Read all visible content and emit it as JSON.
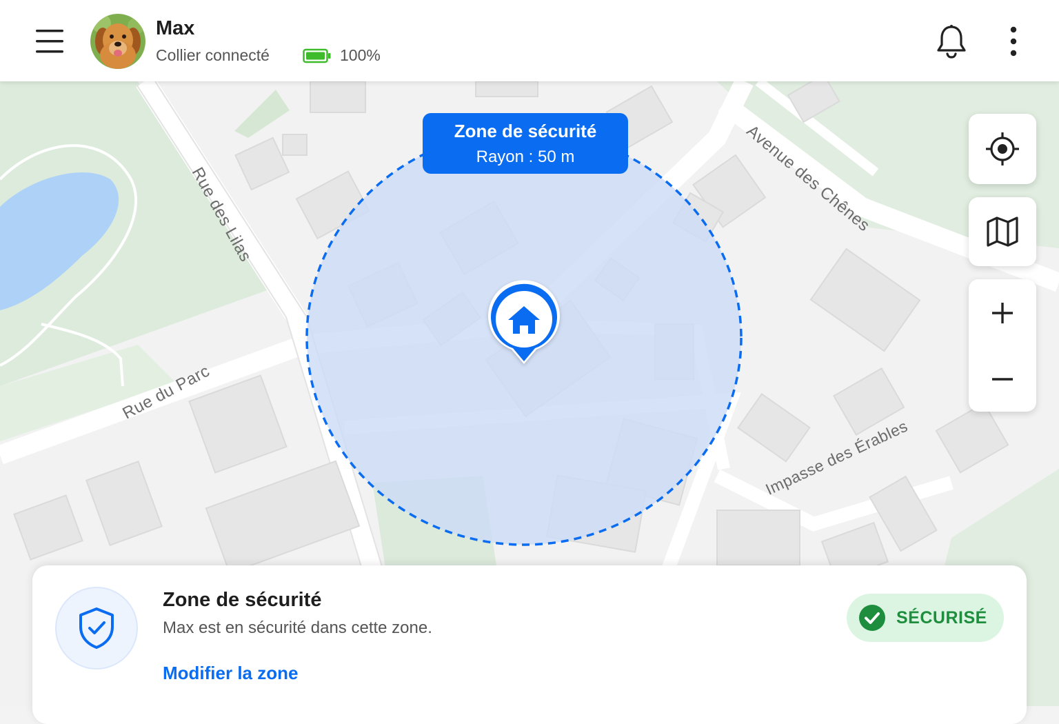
{
  "header": {
    "pet_name": "Max",
    "collar_status": "Collier connecté",
    "battery_level": "100%",
    "battery_fraction": 1.0,
    "battery_color": "#3dbb2a",
    "icons": [
      "menu-icon",
      "dog-avatar",
      "battery-icon",
      "bell-icon",
      "more-vert-icon"
    ]
  },
  "map": {
    "streets": {
      "rue_des_lilas": "Rue des Lilas",
      "rue_du_parc": "Rue du Parc",
      "avenue_des_chenes": "Avenue des Chênes",
      "impasse_des_erables": "Impasse des Érables"
    },
    "zone": {
      "title": "Zone de sécurité",
      "radius_label": "Rayon : 50 m",
      "fill_color": "#cddcf6",
      "stroke_color": "#0a6cf0"
    },
    "controls": [
      "locate-icon",
      "map-layers-icon",
      "zoom-in-icon",
      "zoom-out-icon"
    ]
  },
  "card": {
    "title": "Zone de sécurité",
    "description": "Max est en sécurité dans cette zone.",
    "link": "Modifier la zone",
    "status": "SÉCURISÉ",
    "status_color": "#1e8e3e",
    "accent_color": "#0a6cf0"
  }
}
